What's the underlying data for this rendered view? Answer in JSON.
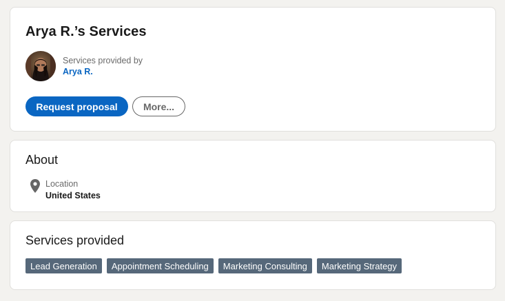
{
  "profile": {
    "title": "Arya R.’s Services",
    "provided_by_label": "Services provided by",
    "provider_name": "Arya R.",
    "avatar_icon": "user-avatar-photo",
    "request_button": "Request proposal",
    "more_button": "More..."
  },
  "about": {
    "title": "About",
    "location_icon": "location-pin-icon",
    "location_label": "Location",
    "location_value": "United States"
  },
  "services": {
    "title": "Services provided",
    "items": [
      "Lead Generation",
      "Appointment Scheduling",
      "Marketing Consulting",
      "Marketing Strategy"
    ]
  },
  "colors": {
    "accent": "#0a66c2",
    "chip_bg": "#56687a",
    "page_bg": "#f3f2ef"
  }
}
